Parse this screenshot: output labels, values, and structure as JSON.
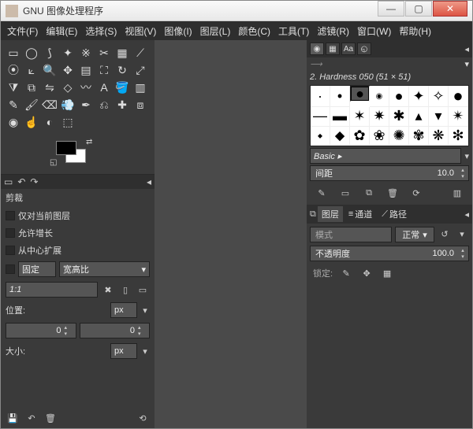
{
  "window": {
    "title": "GNU 图像处理程序"
  },
  "menu": {
    "items": [
      "文件(F)",
      "编辑(E)",
      "选择(S)",
      "视图(V)",
      "图像(I)",
      "图层(L)",
      "颜色(C)",
      "工具(T)",
      "滤镜(R)",
      "窗口(W)",
      "帮助(H)"
    ]
  },
  "toolbox": {
    "tools": [
      "rect",
      "ellipse",
      "lasso",
      "wand",
      "bycolor",
      "scissors",
      "fg-select",
      "paths",
      "picker",
      "measure",
      "move",
      "crop",
      "rotate",
      "scale",
      "flip",
      "cage",
      "warp",
      "text",
      "bucket",
      "gradient",
      "pencil",
      "brush",
      "erase",
      "airbrush",
      "ink",
      "clone",
      "heal",
      "persp-clone",
      "blur",
      "smudge",
      "dodge",
      "cage2",
      "align",
      "zoom",
      "zoom2",
      "rotate-view"
    ]
  },
  "tool_options": {
    "title": "剪裁",
    "only_current_layer": "仅对当前图层",
    "allow_growing": "允许增长",
    "from_center": "从中心扩展",
    "fixed_label": "固定",
    "aspect_label": "宽高比",
    "ratio_value": "1:1",
    "position_label": "位置:",
    "size_label": "大小:",
    "unit": "px",
    "pos_x": "0",
    "pos_y": "0"
  },
  "brushes": {
    "display_name": "2. Hardness 050 (51 × 51)",
    "tag_filter": "Basic ▸",
    "spacing_label": "间距",
    "spacing_value": "10.0"
  },
  "layers": {
    "tabs": [
      "图层",
      "通道",
      "路径"
    ],
    "mode_label": "模式",
    "mode_value": "正常",
    "opacity_label": "不透明度",
    "opacity_value": "100.0",
    "lock_label": "锁定:"
  }
}
